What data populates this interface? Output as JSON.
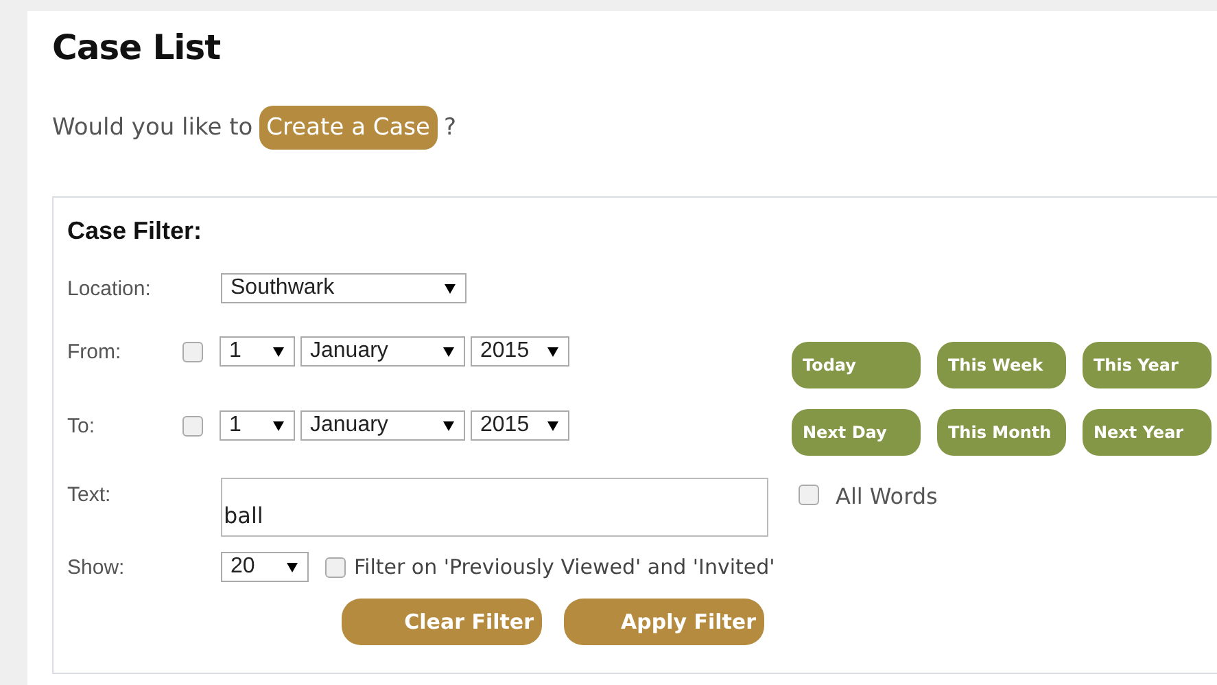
{
  "title": "Case List",
  "prompt": {
    "text": "Would you like to",
    "link": "Create a Case",
    "suffix": "?"
  },
  "filter": {
    "heading": "Case Filter:",
    "location": {
      "label": "Location:",
      "value": "Southwark"
    },
    "dates": [
      {
        "label": "From:",
        "checked": false,
        "day": "1",
        "month": "January",
        "year": "2015"
      },
      {
        "label": "To:",
        "checked": false,
        "day": "1",
        "month": "January",
        "year": "2015"
      }
    ],
    "quick_buttons": [
      "Today",
      "This Week",
      "This Year",
      "Next Day",
      "This Month",
      "Next Year"
    ],
    "text": {
      "label": "Text:",
      "value": "ball"
    },
    "all_words": {
      "label": "All Words",
      "checked": false
    },
    "show": {
      "label": "Show:",
      "value": "20"
    },
    "previously_viewed": {
      "label": "Filter on 'Previously Viewed' and 'Invited'",
      "checked": false
    },
    "buttons": [
      "Clear Filter",
      "Apply Filter"
    ]
  }
}
